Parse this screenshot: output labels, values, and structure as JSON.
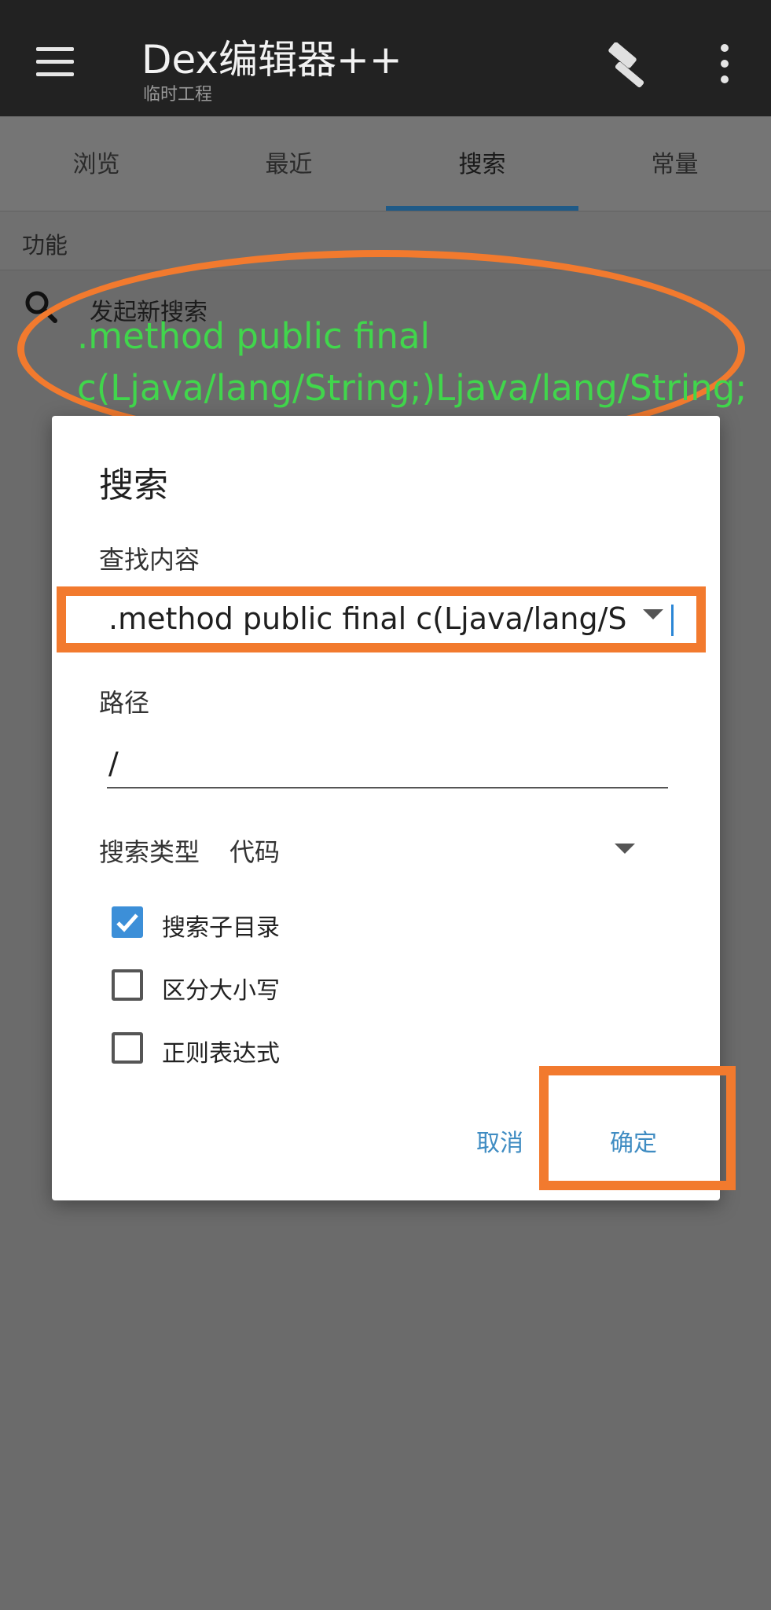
{
  "app": {
    "title": "Dex编辑器++",
    "subtitle": "临时工程",
    "icons": [
      "menu-icon",
      "hammer-icon",
      "more-vert-icon"
    ]
  },
  "tabs": [
    {
      "label": "浏览",
      "active": false
    },
    {
      "label": "最近",
      "active": false
    },
    {
      "label": "搜索",
      "active": true
    },
    {
      "label": "常量",
      "active": false
    }
  ],
  "section": {
    "label": "功能"
  },
  "search_row": {
    "label": "发起新搜索",
    "icon": "search-icon"
  },
  "annotation": {
    "text": ".method public final c(Ljava/lang/String;)Ljava/lang/String;",
    "color": "#41d64c",
    "marker_color": "#f27a2e"
  },
  "dialog": {
    "title": "搜索",
    "find_label": "查找内容",
    "find_value": ".method public final c(Ljava/lang/S",
    "path_label": "路径",
    "path_value": "/",
    "type_label": "搜索类型",
    "type_value": "代码",
    "checkboxes": [
      {
        "label": "搜索子目录",
        "checked": true
      },
      {
        "label": "区分大小写",
        "checked": false
      },
      {
        "label": "正则表达式",
        "checked": false
      }
    ],
    "cancel_label": "取消",
    "confirm_label": "确定",
    "accent_color": "#3c8fd8"
  }
}
